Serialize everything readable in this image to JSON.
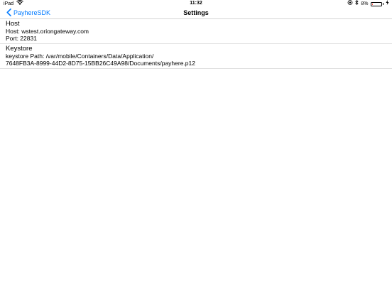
{
  "status_bar": {
    "device": "iPad",
    "time": "11:32",
    "battery_percent": "8%",
    "battery_level": 0.08,
    "battery_color": "#ff3b30"
  },
  "nav": {
    "back_label": "PayhereSDK",
    "title": "Settings",
    "accent": "#007aff"
  },
  "sections": {
    "host": {
      "title": "Host",
      "line1": "Host: wstest.oriongateway.com",
      "line2": "Port: 22831"
    },
    "keystore": {
      "title": "Keystore",
      "line1": "keystore Path: /var/mobile/Containers/Data/Application/",
      "line2": "7648FB3A-8999-44D2-8D75-15BB26C49A98/Documents/payhere.p12"
    }
  }
}
